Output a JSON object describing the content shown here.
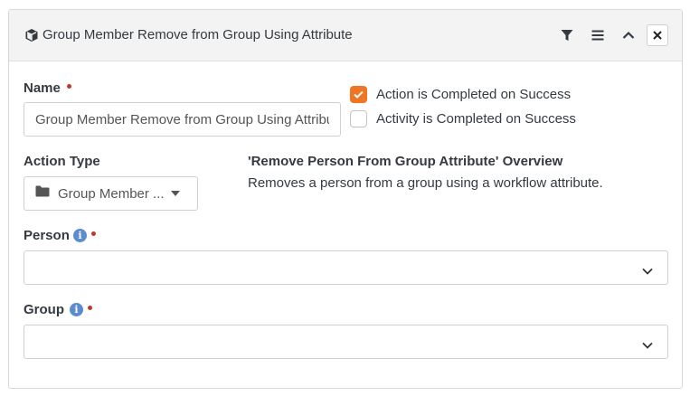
{
  "panel": {
    "title": "Group Member Remove from Group Using Attribute",
    "icon": "cube-icon",
    "actions": [
      "filter-icon",
      "menu-icon",
      "chevron-up-icon",
      "close-icon"
    ]
  },
  "form": {
    "name": {
      "label": "Name",
      "value": "Group Member Remove from Group Using Attribute"
    },
    "checkboxes": [
      {
        "label": "Action is Completed on Success",
        "checked": true
      },
      {
        "label": "Activity is Completed on Success",
        "checked": false
      }
    ],
    "action_type": {
      "label": "Action Type",
      "selected": "Group Member ...",
      "icon": "folder-icon"
    },
    "overview": {
      "title": "'Remove Person From Group Attribute' Overview",
      "description": "Removes a person from a group using a workflow attribute."
    },
    "person": {
      "label": "Person",
      "value": ""
    },
    "group": {
      "label": "Group",
      "value": ""
    }
  },
  "colors": {
    "accent": "#ee7625",
    "required": "#c0392b",
    "info": "#5b8ccf",
    "header_bg": "#f3f3f3"
  }
}
